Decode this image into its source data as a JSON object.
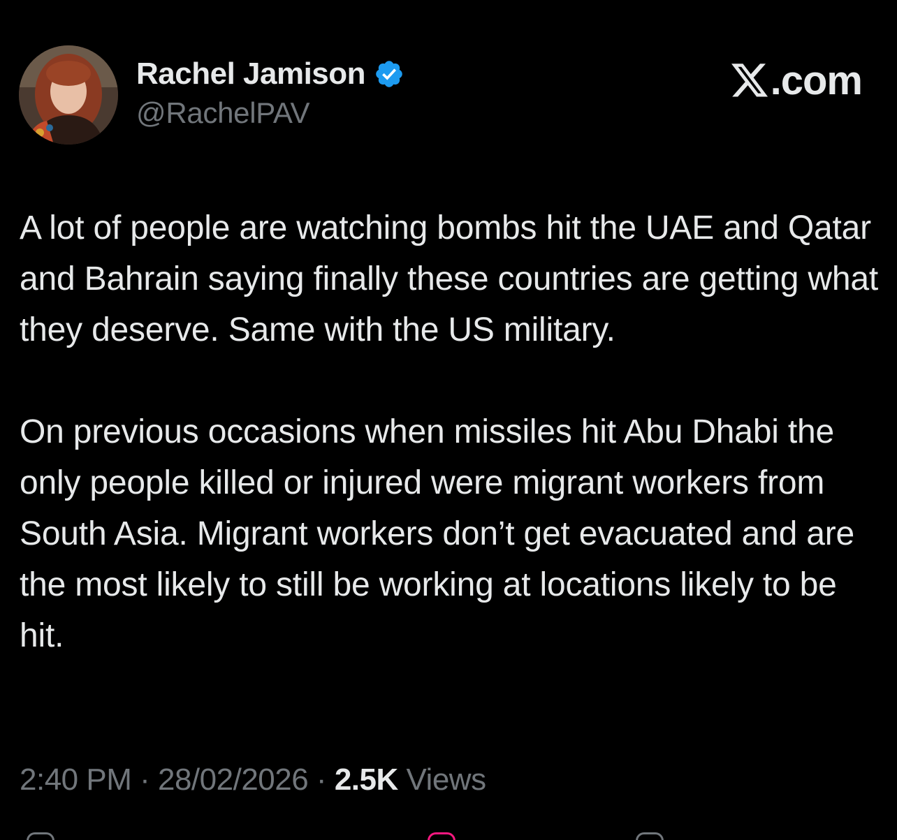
{
  "author": {
    "display_name": "Rachel Jamison",
    "handle": "@RachelPAV",
    "verified": true,
    "verified_color": "#1d9bf0"
  },
  "brand": {
    "text": ".com",
    "icon": "x-logo-icon"
  },
  "tweet": {
    "paragraphs": [
      "A lot of people are watching bombs hit the UAE and Qatar and Bahrain saying finally these countries are getting what they deserve. Same with the US military.",
      "On previous occasions when missiles hit Abu Dhabi the only people killed or injured were migrant workers from South Asia. Migrant workers don’t get evacuated and are the most likely to still be working at locations likely to be hit."
    ]
  },
  "meta": {
    "time": "2:40 PM",
    "separator": " · ",
    "date": "28/02/2026",
    "views_count": "2.5K",
    "views_label": "Views"
  },
  "colors": {
    "background": "#000000",
    "primary_text": "#e7e9ea",
    "secondary_text": "#71767b",
    "like_accent": "#f91880"
  },
  "actions": [
    {
      "icon": "reply-icon"
    },
    {
      "icon": "like-icon"
    },
    {
      "icon": "bookmark-icon"
    }
  ]
}
